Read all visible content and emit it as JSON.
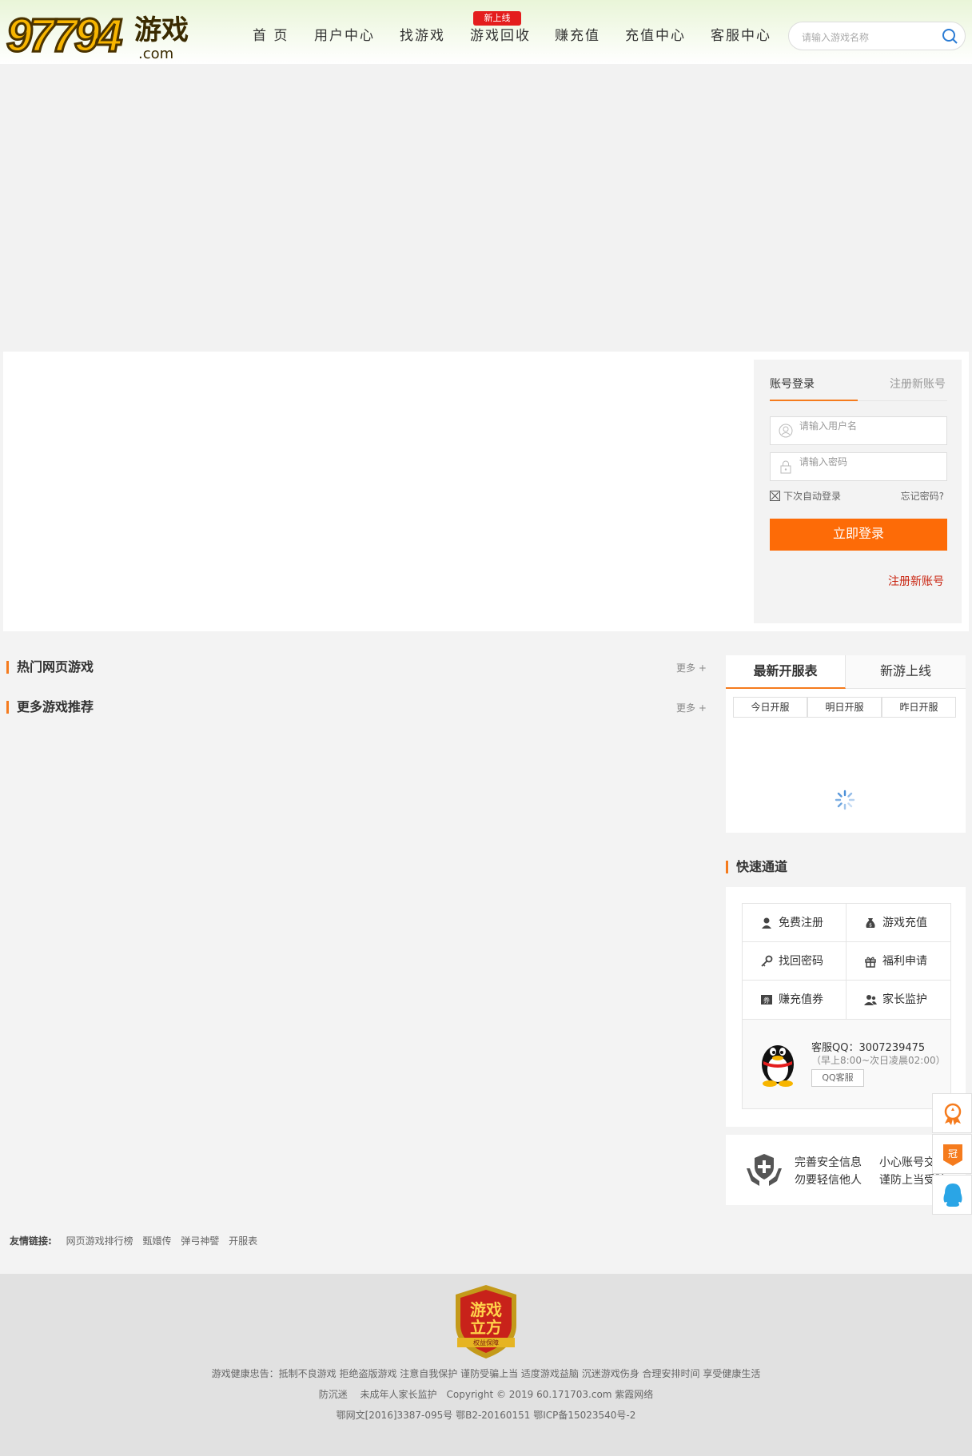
{
  "header": {
    "logo_number": "97794",
    "logo_cn": "游戏",
    "logo_domain": ".com",
    "nav": [
      {
        "label": "首 页"
      },
      {
        "label": "用户中心"
      },
      {
        "label": "找游戏"
      },
      {
        "label": "游戏回收"
      },
      {
        "label": "赚充值"
      },
      {
        "label": "充值中心"
      },
      {
        "label": "客服中心"
      }
    ],
    "new_badge": "新上线",
    "search_placeholder": "请输入游戏名称"
  },
  "login": {
    "tab_login": "账号登录",
    "tab_register": "注册新账号",
    "username_placeholder": "请输入用户名",
    "password_placeholder": "请输入密码",
    "remember": "下次自动登录",
    "forgot": "忘记密码?",
    "submit": "立即登录",
    "register_link": "注册新账号"
  },
  "sections": {
    "hot_games": "热门网页游戏",
    "more_games": "更多游戏推荐",
    "more": "更多 +"
  },
  "servers": {
    "tab_latest": "最新开服表",
    "tab_new_games": "新游上线",
    "subtabs": [
      "今日开服",
      "明日开服",
      "昨日开服"
    ]
  },
  "quick": {
    "title": "快速通道",
    "items": [
      {
        "label": "免费注册",
        "icon": "user-icon"
      },
      {
        "label": "游戏充值",
        "icon": "money-bag-icon"
      },
      {
        "label": "找回密码",
        "icon": "key-icon"
      },
      {
        "label": "福利申请",
        "icon": "gift-icon"
      },
      {
        "label": "赚充值券",
        "icon": "coupon-icon"
      },
      {
        "label": "家长监护",
        "icon": "parents-icon"
      }
    ],
    "qq_label": "客服QQ：3007239475",
    "qq_hours": "（早上8:00~次日凌晨02:00）",
    "qq_button": "QQ客服"
  },
  "safety": {
    "line1a": "完善安全信息",
    "line1b": "小心账号交易",
    "line2a": "勿要轻信他人",
    "line2b": "谨防上当受骗"
  },
  "friend_links": {
    "label": "友情链接:",
    "items": [
      "网页游戏排行榜",
      "甄嬛传",
      "弹弓神譬",
      "开服表"
    ]
  },
  "footer": {
    "badge_line1": "游戏",
    "badge_line2": "立方",
    "badge_ribbon": "权益保障",
    "notice": "游戏健康忠告：抵制不良游戏 拒绝盗版游戏 注意自我保护 谨防受骗上当 适度游戏益脑 沉迷游戏伤身 合理安排时间 享受健康生活",
    "line2": "防沉迷　 未成年人家长监护　Copyright © 2019  60.171703.com  紫霞网络",
    "line3": "鄂网文[2016]3387-095号  鄂B2-20160151  鄂ICP备15023540号-2"
  },
  "colors": {
    "accent": "#f57b1d",
    "button": "#fd6b07",
    "badge": "#e41d1d",
    "link_red": "#c9230f"
  }
}
